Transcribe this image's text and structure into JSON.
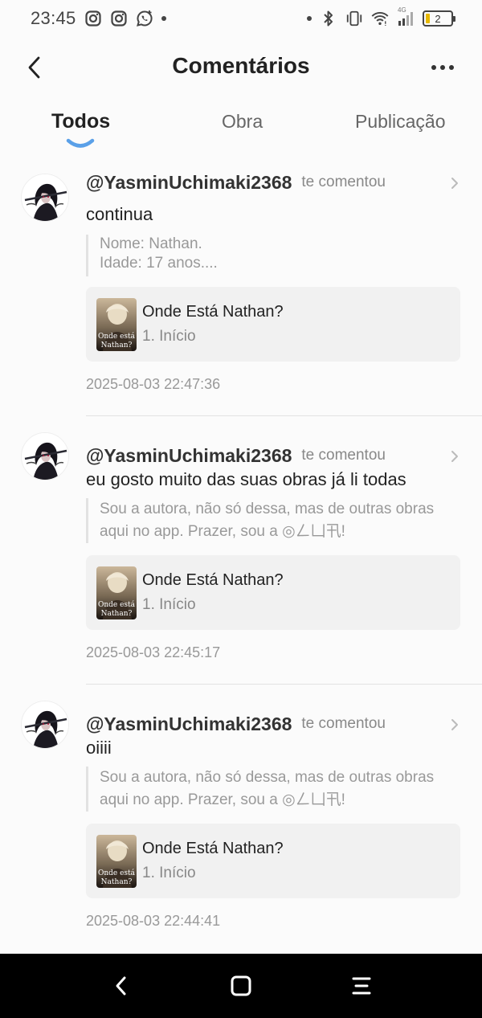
{
  "status_bar": {
    "time": "23:45",
    "battery_level": "2",
    "network_label": "4G",
    "notification_icons": [
      "instagram-icon",
      "instagram-icon",
      "whatsapp-icon"
    ],
    "system_icons": [
      "bluetooth-icon",
      "vibrate-icon",
      "wifi-icon",
      "signal-icon",
      "battery-icon"
    ]
  },
  "header": {
    "title": "Comentários"
  },
  "tabs": [
    {
      "label": "Todos",
      "active": true
    },
    {
      "label": "Obra",
      "active": false
    },
    {
      "label": "Publicação",
      "active": false
    }
  ],
  "colors": {
    "accent": "#5aa0e8",
    "background": "#fbfbfb",
    "card": "#f1f1f1"
  },
  "comments": [
    {
      "username": "@YasminUchimaki2368",
      "action": "te comentou",
      "text": "continua",
      "quote_lines": [
        "Nome: Nathan.",
        "Idade: 17 anos...."
      ],
      "work_title": "Onde Está Nathan?",
      "work_chapter": "1. Início",
      "cover_text": "Onde está Nathan?",
      "timestamp": "2025-08-03 22:47:36"
    },
    {
      "username": "@YasminUchimaki2368",
      "action": "te comentou",
      "text": "eu gosto muito das suas obras já li todas",
      "quote_lines": [
        "Sou a autora, não só dessa, mas de outras obras",
        "aqui no app. Prazer, sou a ◎ㄥ凵卂!"
      ],
      "work_title": "Onde Está Nathan?",
      "work_chapter": "1. Início",
      "cover_text": "Onde está Nathan?",
      "timestamp": "2025-08-03 22:45:17"
    },
    {
      "username": "@YasminUchimaki2368",
      "action": "te comentou",
      "text": "oiiii",
      "quote_lines": [
        "Sou a autora, não só dessa, mas de outras obras",
        "aqui no app. Prazer, sou a ◎ㄥ凵卂!"
      ],
      "work_title": "Onde Está Nathan?",
      "work_chapter": "1. Início",
      "cover_text": "Onde está Nathan?",
      "timestamp": "2025-08-03 22:44:41"
    }
  ]
}
